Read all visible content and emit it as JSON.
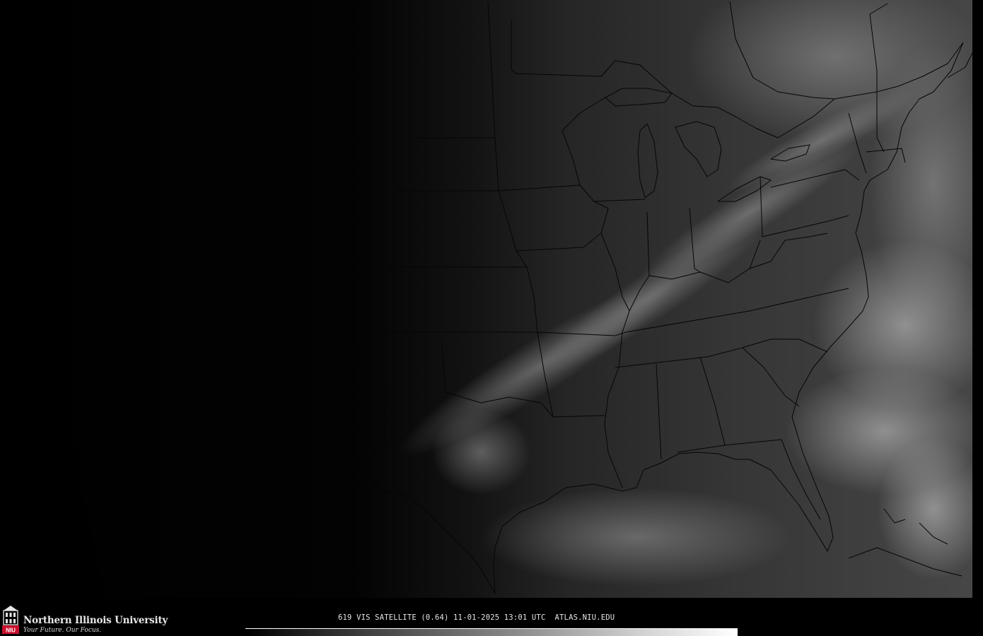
{
  "image": {
    "product_caption": "619 VIS SATELLITE (0.64) 11-01-2025 13:01 UTC  ATLAS.NIU.EDU"
  },
  "logo": {
    "name": "Northern Illinois University",
    "tagline": "Your Future. Our Focus.",
    "mark_letters": "NIU"
  },
  "colors": {
    "background": "#000000",
    "borders": "#050505",
    "logo_red": "#c8102e"
  },
  "icons": {
    "logo_mark": "niu-tower-icon"
  }
}
